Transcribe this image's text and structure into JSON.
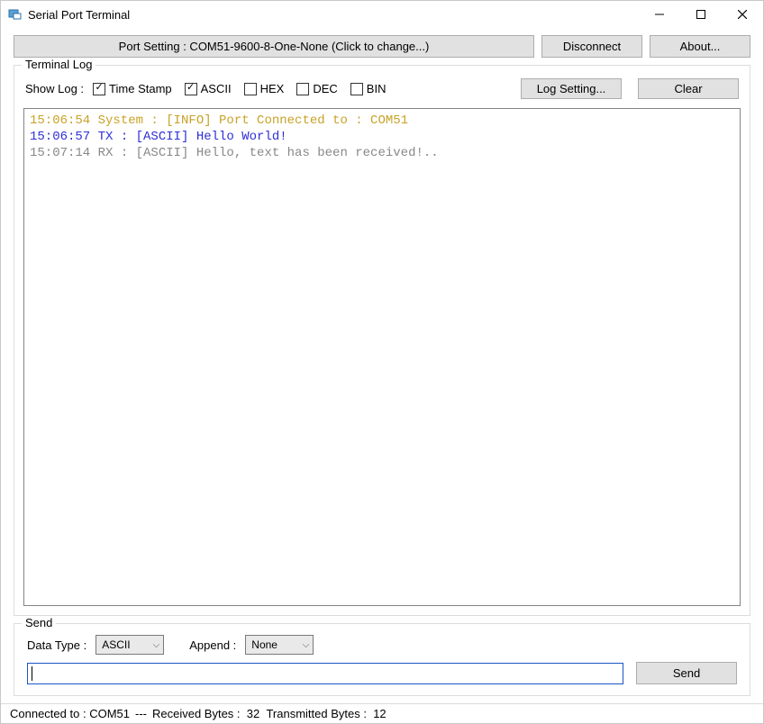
{
  "window": {
    "title": "Serial Port Terminal"
  },
  "toolbar": {
    "port_setting_label": "Port Setting : COM51-9600-8-One-None (Click to change...)",
    "disconnect_label": "Disconnect",
    "about_label": "About..."
  },
  "terminal_log": {
    "legend": "Terminal Log",
    "show_log_label": "Show Log :",
    "checkboxes": {
      "time_stamp": {
        "label": "Time Stamp",
        "checked": true
      },
      "ascii": {
        "label": "ASCII",
        "checked": true
      },
      "hex": {
        "label": "HEX",
        "checked": false
      },
      "dec": {
        "label": "DEC",
        "checked": false
      },
      "bin": {
        "label": "BIN",
        "checked": false
      }
    },
    "log_setting_label": "Log Setting...",
    "clear_label": "Clear",
    "lines": [
      {
        "text": "15:06:54 System : [INFO] Port Connected to : COM51",
        "style": "line1"
      },
      {
        "text": "15:06:57 TX : [ASCII] Hello World!",
        "style": "line2"
      },
      {
        "text": "15:07:14 RX : [ASCII] Hello, text has been received!..",
        "style": "line3"
      }
    ]
  },
  "send": {
    "legend": "Send",
    "data_type_label": "Data Type :",
    "data_type_value": "ASCII",
    "append_label": "Append :",
    "append_value": "None",
    "input_value": "",
    "send_label": "Send"
  },
  "status": {
    "connected_label": "Connected to :",
    "connected_value": "COM51",
    "dash": "---",
    "received_label": "Received Bytes :",
    "received_value": "32",
    "transmitted_label": "Transmitted Bytes :",
    "transmitted_value": "12"
  }
}
